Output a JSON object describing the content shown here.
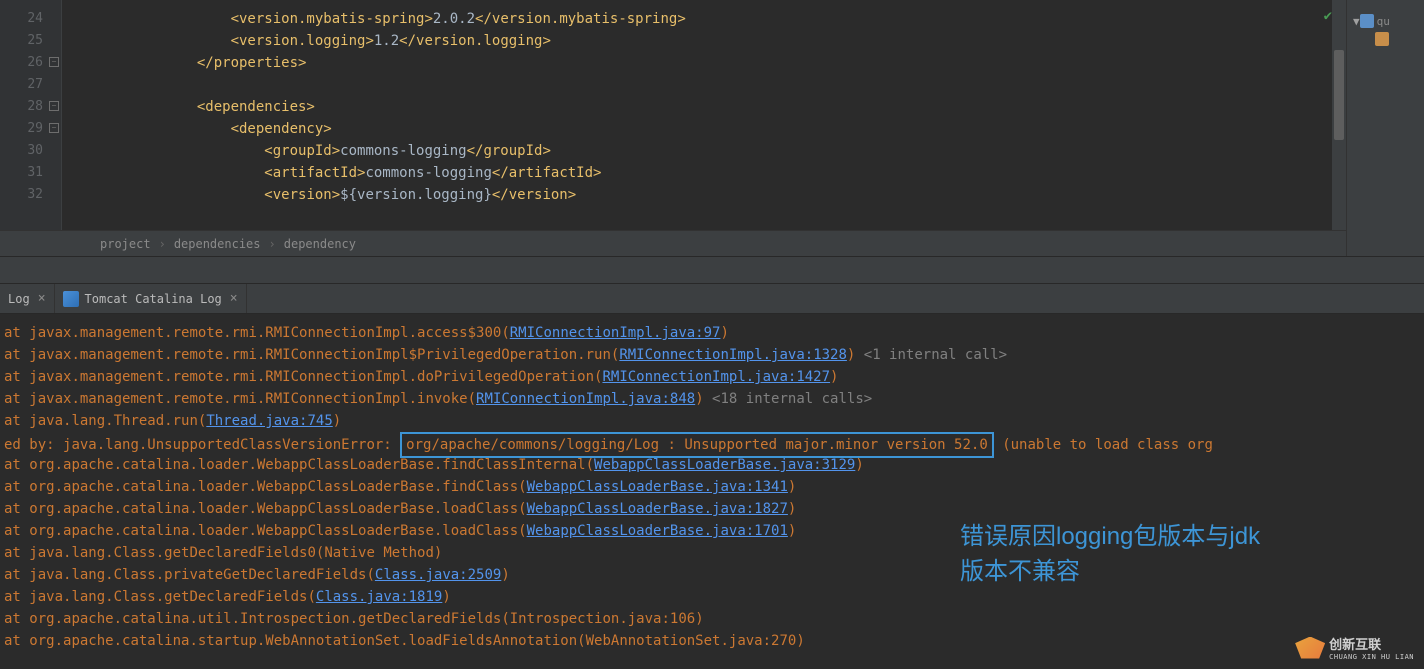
{
  "editor": {
    "lines": [
      {
        "num": "24",
        "fold": false,
        "indent": 5,
        "content": [
          {
            "t": "tag",
            "v": "<version.mybatis-spring>"
          },
          {
            "t": "txt",
            "v": "2.0.2"
          },
          {
            "t": "tag",
            "v": "</version.mybatis-spring>"
          }
        ]
      },
      {
        "num": "25",
        "fold": false,
        "indent": 5,
        "content": [
          {
            "t": "tag",
            "v": "<version.logging>"
          },
          {
            "t": "txt",
            "v": "1.2"
          },
          {
            "t": "tag",
            "v": "</version.logging>"
          }
        ]
      },
      {
        "num": "26",
        "fold": true,
        "indent": 4,
        "content": [
          {
            "t": "tag",
            "v": "</properties>"
          }
        ]
      },
      {
        "num": "27",
        "fold": false,
        "indent": 0,
        "content": []
      },
      {
        "num": "28",
        "fold": true,
        "indent": 4,
        "content": [
          {
            "t": "tag",
            "v": "<dependencies>"
          }
        ]
      },
      {
        "num": "29",
        "fold": true,
        "indent": 5,
        "content": [
          {
            "t": "tag",
            "v": "<dependency>"
          }
        ]
      },
      {
        "num": "30",
        "fold": false,
        "indent": 6,
        "content": [
          {
            "t": "tag",
            "v": "<groupId>"
          },
          {
            "t": "txt",
            "v": "commons-logging"
          },
          {
            "t": "tag",
            "v": "</groupId>"
          }
        ]
      },
      {
        "num": "31",
        "fold": false,
        "indent": 6,
        "content": [
          {
            "t": "tag",
            "v": "<artifactId>"
          },
          {
            "t": "txt",
            "v": "commons-logging"
          },
          {
            "t": "tag",
            "v": "</artifactId>"
          }
        ]
      },
      {
        "num": "32",
        "fold": false,
        "indent": 6,
        "content": [
          {
            "t": "tag",
            "v": "<version>"
          },
          {
            "t": "txt",
            "v": "${version.logging}"
          },
          {
            "t": "tag",
            "v": "</version>"
          }
        ]
      }
    ]
  },
  "breadcrumb": {
    "a": "project",
    "b": "dependencies",
    "c": "dependency"
  },
  "rightPanel": {
    "item1": "qu"
  },
  "tabs": {
    "tab1": "Log",
    "tab2": "Tomcat Catalina Log"
  },
  "console": {
    "l1": {
      "pre": "at ",
      "path": "javax.management.remote.rmi.RMIConnectionImpl.access$300",
      "paren": "(",
      "link": "RMIConnectionImpl.java:97",
      "close": ")"
    },
    "l2": {
      "pre": "at ",
      "path": "javax.management.remote.rmi.RMIConnectionImpl$PrivilegedOperation.run",
      "paren": "(",
      "link": "RMIConnectionImpl.java:1328",
      "close": ")",
      "extra": " <1 internal call>"
    },
    "l3": {
      "pre": "at ",
      "path": "javax.management.remote.rmi.RMIConnectionImpl.doPrivilegedOperation",
      "paren": "(",
      "link": "RMIConnectionImpl.java:1427",
      "close": ")"
    },
    "l4": {
      "pre": "at ",
      "path": "javax.management.remote.rmi.RMIConnectionImpl.invoke",
      "paren": "(",
      "link": "RMIConnectionImpl.java:848",
      "close": ")",
      "extra": " <18 internal calls>"
    },
    "l5": {
      "pre": "at ",
      "path": "java.lang.Thread.run",
      "paren": "(",
      "link": "Thread.java:745",
      "close": ")"
    },
    "l6": {
      "pre": "ed by: ",
      "exc": "java.lang.UnsupportedClassVersionError: ",
      "boxed": "org/apache/commons/logging/Log : Unsupported major.minor version 52.0",
      "post": " (unable to load class org"
    },
    "l7": {
      "pre": "at ",
      "path": "org.apache.catalina.loader.WebappClassLoaderBase.findClassInternal",
      "paren": "(",
      "link": "WebappClassLoaderBase.java:3129",
      "close": ")"
    },
    "l8": {
      "pre": "at ",
      "path": "org.apache.catalina.loader.WebappClassLoaderBase.findClass",
      "paren": "(",
      "link": "WebappClassLoaderBase.java:1341",
      "close": ")"
    },
    "l9": {
      "pre": "at ",
      "path": "org.apache.catalina.loader.WebappClassLoaderBase.loadClass",
      "paren": "(",
      "link": "WebappClassLoaderBase.java:1827",
      "close": ")"
    },
    "l10": {
      "pre": "at ",
      "path": "org.apache.catalina.loader.WebappClassLoaderBase.loadClass",
      "paren": "(",
      "link": "WebappClassLoaderBase.java:1701",
      "close": ")"
    },
    "l11": {
      "pre": "at ",
      "path": "java.lang.Class.getDeclaredFields0",
      "paren": "(",
      "plain": "Native Method",
      "close": ")"
    },
    "l12": {
      "pre": "at ",
      "path": "java.lang.Class.privateGetDeclaredFields",
      "paren": "(",
      "link": "Class.java:2509",
      "close": ")"
    },
    "l13": {
      "pre": "at ",
      "path": "java.lang.Class.getDeclaredFields",
      "paren": "(",
      "link": "Class.java:1819",
      "close": ")"
    },
    "l14": {
      "pre": "at ",
      "path": "org.apache.catalina.util.Introspection.getDeclaredFields",
      "paren": "(",
      "plain": "Introspection.java:106",
      "close": ")"
    },
    "l15": {
      "pre": "at ",
      "path": "org.apache.catalina.startup.WebAnnotationSet.loadFieldsAnnotation",
      "paren": "(",
      "plain": "WebAnnotationSet.java:270",
      "close": ")"
    }
  },
  "annotation": {
    "line1": "错误原因logging包版本与jdk",
    "line2": "版本不兼容"
  },
  "logo": {
    "brand": "创新互联",
    "sub": "CHUANG XIN HU LIAN"
  }
}
